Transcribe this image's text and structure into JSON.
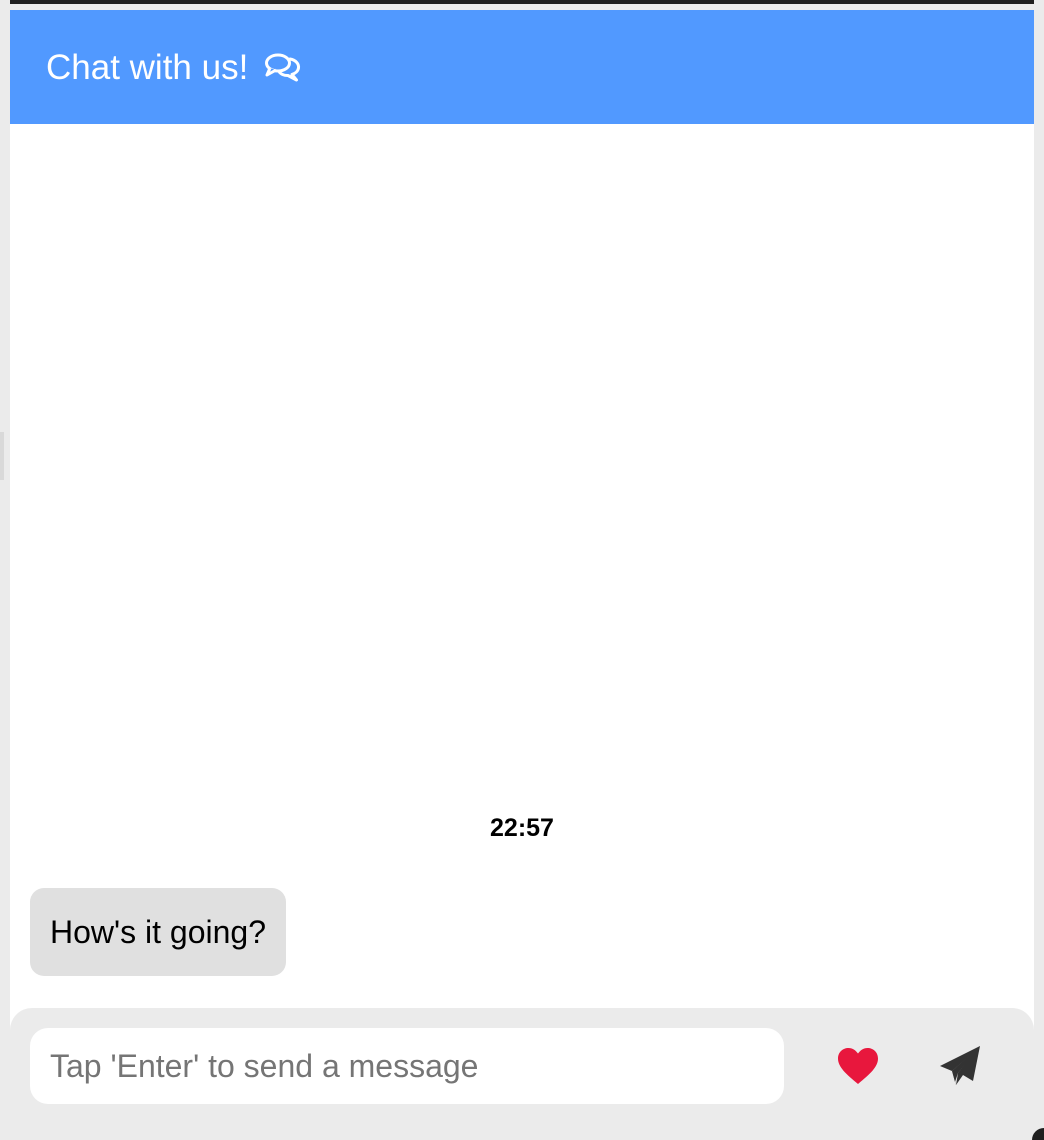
{
  "header": {
    "title": "Chat with us!",
    "icon": "chat-bubbles-icon",
    "background_color": "#5199ff"
  },
  "conversation": {
    "timestamp": "22:57",
    "messages": [
      {
        "text": "How's it going?"
      }
    ]
  },
  "composer": {
    "input_value": "",
    "input_placeholder": "Tap 'Enter' to send a message",
    "like_icon": "heart-icon",
    "like_color": "#e8173d",
    "send_icon": "paper-plane-icon"
  }
}
